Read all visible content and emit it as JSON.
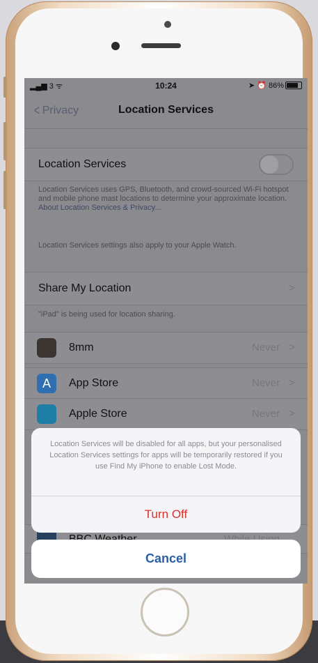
{
  "status_bar": {
    "signal": "3",
    "time": "10:24",
    "battery_text": "86%"
  },
  "nav": {
    "back_label": "Privacy",
    "title": "Location Services"
  },
  "location_services": {
    "label": "Location Services",
    "toggle_on": false,
    "description": "Location Services uses GPS, Bluetooth, and crowd-sourced Wi-Fi hotspot and mobile phone mast locations to determine your approximate location.",
    "link": "About Location Services & Privacy...",
    "watch_note": "Location Services settings also apply to your Apple Watch."
  },
  "share_location": {
    "label": "Share My Location",
    "note": "\"iPad\" is being used for location sharing."
  },
  "apps": [
    {
      "name": "8mm",
      "value": "Never",
      "icon": "film-camera-icon",
      "color": "#3a3531"
    },
    {
      "name": "App Store",
      "value": "Never",
      "icon": "app-store-icon",
      "color": "#2f6fb0"
    },
    {
      "name": "Apple Store",
      "value": "Never",
      "icon": "shopping-bag-icon",
      "color": "#1e7fa6"
    },
    {
      "name": "BBC Weather",
      "value": "While Using",
      "icon": "bbc-weather-icon",
      "color": "#25415e"
    }
  ],
  "action_sheet": {
    "message": "Location Services will be disabled for all apps, but your personalised Location Services settings for apps will be temporarily restored if you use Find My iPhone to enable Lost Mode.",
    "destructive_label": "Turn Off",
    "cancel_label": "Cancel"
  },
  "colors": {
    "destructive": "#d9302a",
    "cancel": "#2c5ea8",
    "frame": "#e8c9a8"
  }
}
